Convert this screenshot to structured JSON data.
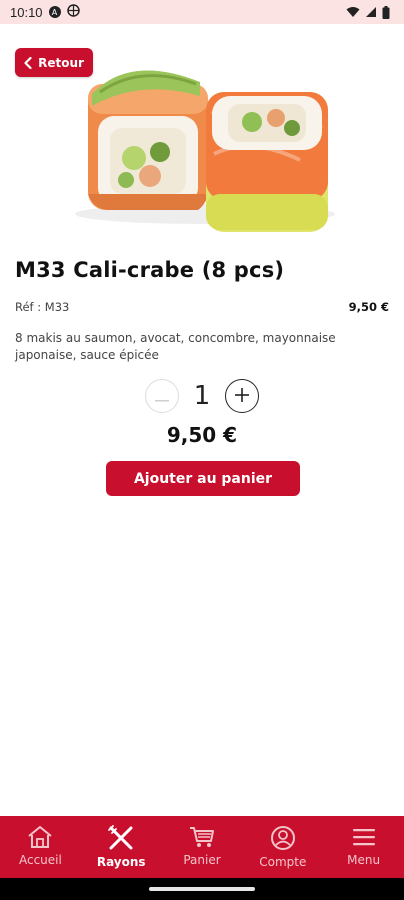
{
  "status_bar": {
    "time": "10:10",
    "icons": [
      "a-circle-icon",
      "target-circle-icon",
      "wifi-icon",
      "signal-icon",
      "battery-icon"
    ]
  },
  "header": {
    "back_label": "Retour"
  },
  "product": {
    "image": "sushi-roll-salmon-avocado",
    "title": "M33 Cali-crabe (8 pcs)",
    "ref": "Réf : M33",
    "unit_price": "9,50 €",
    "description": "8 makis au saumon, avocat, concombre, mayonnaise japonaise, sauce épicée",
    "quantity": "1",
    "total_price": "9,50 €",
    "add_to_cart_label": "Ajouter au panier"
  },
  "bottom_nav": {
    "items": [
      {
        "label": "Accueil",
        "icon": "home-icon",
        "active": false
      },
      {
        "label": "Rayons",
        "icon": "cutlery-icon",
        "active": true
      },
      {
        "label": "Panier",
        "icon": "cart-icon",
        "active": false
      },
      {
        "label": "Compte",
        "icon": "account-icon",
        "active": false
      },
      {
        "label": "Menu",
        "icon": "hamburger-icon",
        "active": false
      }
    ]
  },
  "colors": {
    "brand_red": "#c8102e",
    "status_bar_bg": "#fbe3e3",
    "nav_inactive": "#f3c4c9"
  }
}
